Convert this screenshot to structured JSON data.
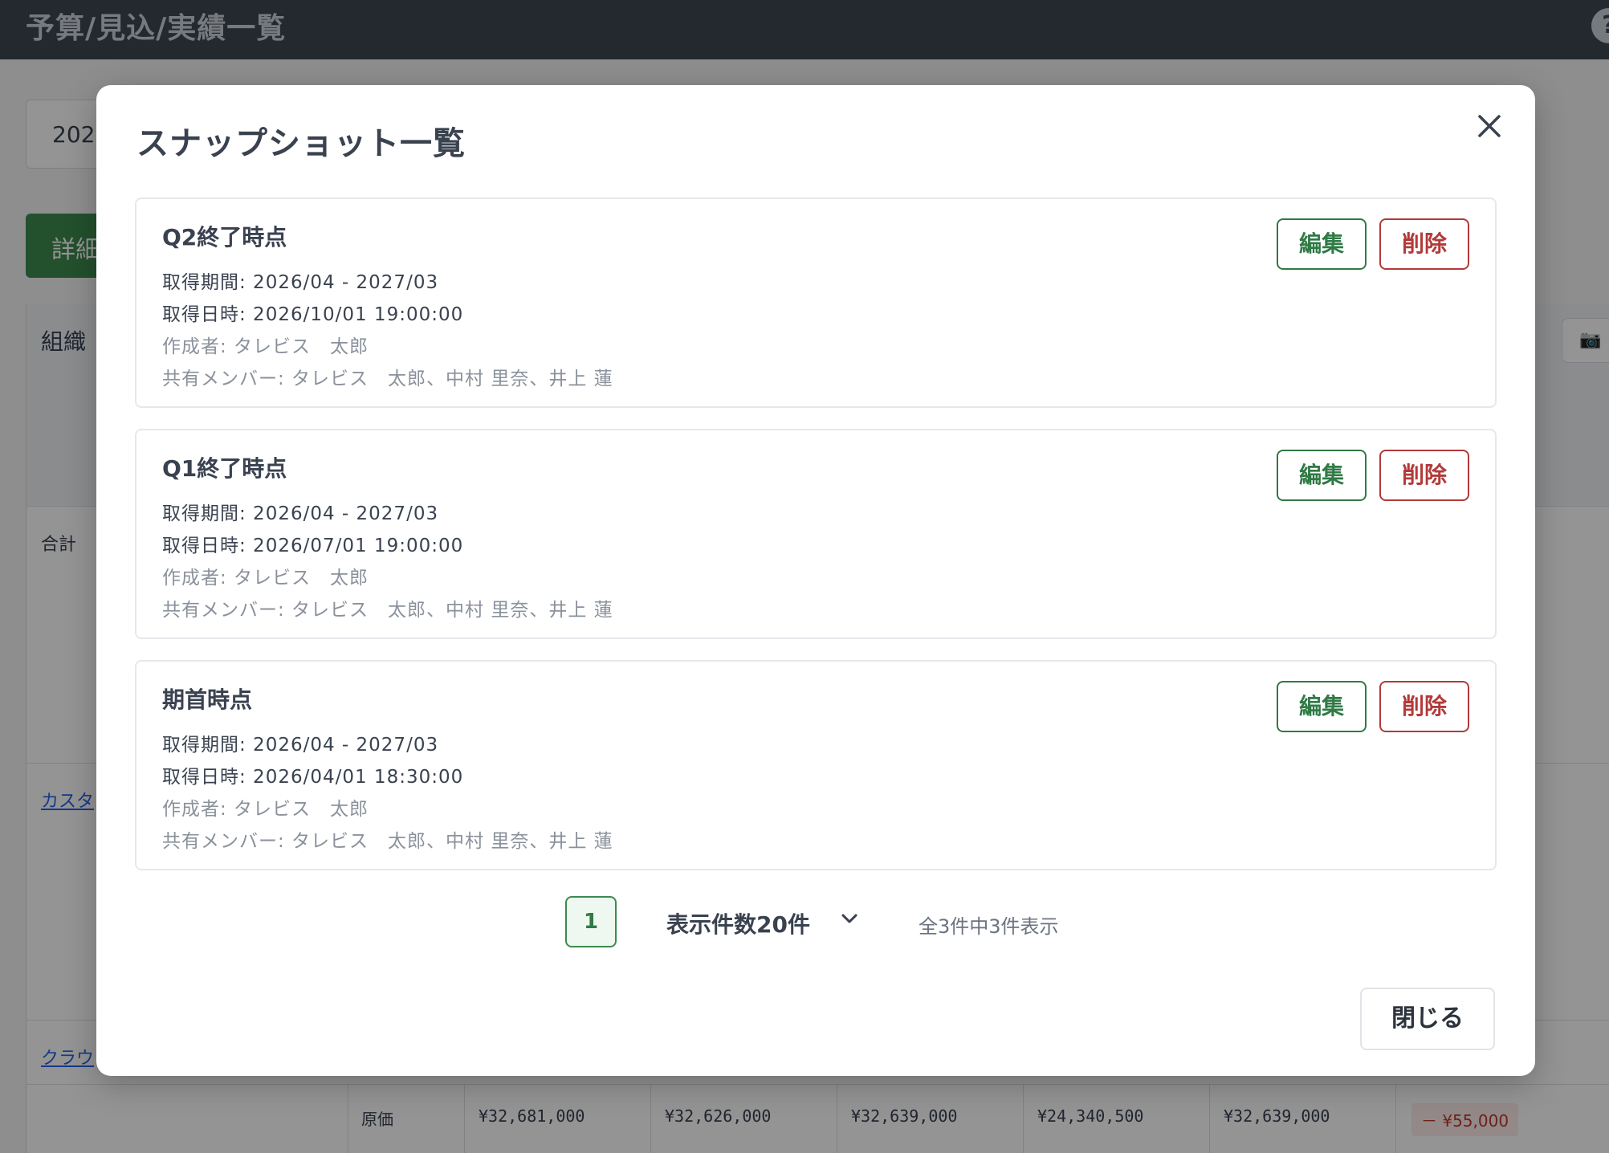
{
  "background": {
    "page_title": "予算/見込/実績一覧",
    "help_icon": "?",
    "year_select_value": "202",
    "detail_button_label": "詳細",
    "org_column_label": "組織",
    "camera_icon": "camera-icon",
    "rows": {
      "total_label": "合計",
      "customer_link": "カスタ",
      "cloud_link": "クラウ"
    },
    "cost_row": {
      "label": "原価",
      "values": [
        "¥32,681,000",
        "¥32,626,000",
        "¥32,639,000",
        "¥24,340,500",
        "¥32,639,000"
      ],
      "diff": "－ ¥55,000"
    }
  },
  "modal": {
    "title": "スナップショット一覧",
    "close_icon": "close-icon",
    "edit_label": "編集",
    "delete_label": "削除",
    "snapshots": [
      {
        "name": "Q2終了時点",
        "period": "取得期間: 2026/04 - 2027/03",
        "datetime": "取得日時: 2026/10/01 19:00:00",
        "author": "作成者: タレビス　太郎",
        "members": "共有メンバー: タレビス　太郎、中村 里奈、井上 蓮"
      },
      {
        "name": "Q1終了時点",
        "period": "取得期間: 2026/04 - 2027/03",
        "datetime": "取得日時: 2026/07/01 19:00:00",
        "author": "作成者: タレビス　太郎",
        "members": "共有メンバー: タレビス　太郎、中村 里奈、井上 蓮"
      },
      {
        "name": "期首時点",
        "period": "取得期間: 2026/04 - 2027/03",
        "datetime": "取得日時: 2026/04/01 18:30:00",
        "author": "作成者: タレビス　太郎",
        "members": "共有メンバー: タレビス　太郎、中村 里奈、井上 蓮"
      }
    ],
    "pagination": {
      "current_page": "1",
      "per_page_label": "表示件数20件",
      "chevron_icon": "chevron-down-icon",
      "summary": "全3件中3件表示"
    },
    "close_button_label": "閉じる"
  },
  "colors": {
    "topbar": "#3f4651",
    "primary_green": "#3d8a4f",
    "danger_red": "#b23a3a",
    "overlay": "rgba(0,0,0,0.42)"
  }
}
